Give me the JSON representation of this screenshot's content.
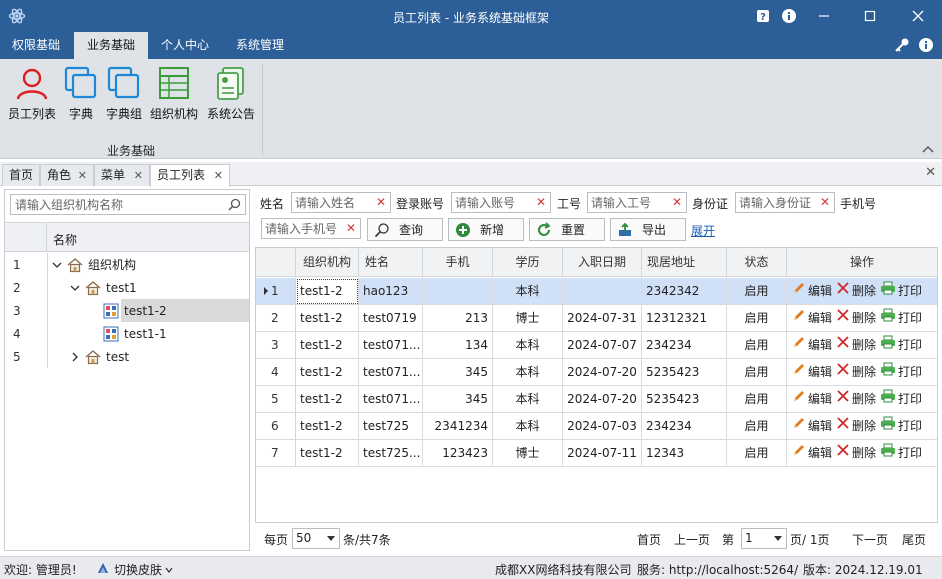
{
  "window": {
    "title": "员工列表 - 业务系统基础框架",
    "colors": {
      "titlebar": "#2c5f98",
      "ribbon": "#dfe3e8"
    }
  },
  "ribbon": {
    "tabs": [
      "权限基础",
      "业务基础",
      "个人中心",
      "系统管理"
    ],
    "active_tab": "业务基础",
    "buttons": [
      {
        "label": "员工列表",
        "icon": "person-icon"
      },
      {
        "label": "字典",
        "icon": "copy-icon"
      },
      {
        "label": "字典组",
        "icon": "copy-icon"
      },
      {
        "label": "组织机构",
        "icon": "table-icon"
      },
      {
        "label": "系统公告",
        "icon": "notice-icon"
      }
    ],
    "group_label": "业务基础"
  },
  "doc_tabs": [
    {
      "label": "首页",
      "closable": false
    },
    {
      "label": "角色",
      "closable": true
    },
    {
      "label": "菜单",
      "closable": true
    },
    {
      "label": "员工列表",
      "closable": true,
      "active": true
    }
  ],
  "tree": {
    "search_placeholder": "请输入组织机构名称",
    "column_header": "名称",
    "rows": [
      {
        "num": "1",
        "label": "组织机构",
        "expanded": true,
        "icon": "home-icon"
      },
      {
        "num": "2",
        "label": "test1",
        "expanded": true,
        "icon": "home-icon"
      },
      {
        "num": "3",
        "label": "test1-2",
        "icon": "org-leaf-icon",
        "selected": true
      },
      {
        "num": "4",
        "label": "test1-1",
        "icon": "org-leaf-icon"
      },
      {
        "num": "5",
        "label": "test",
        "expanded": false,
        "icon": "home-icon"
      }
    ]
  },
  "filters": {
    "name_label": "姓名",
    "name_placeholder": "请输入姓名",
    "account_label": "登录账号",
    "account_placeholder": "请输入账号",
    "jobno_label": "工号",
    "jobno_placeholder": "请输入工号",
    "idcard_label": "身份证",
    "idcard_placeholder": "请输入身份证",
    "phone_label": "手机号",
    "phone_placeholder": "请输入手机号",
    "query": "查询",
    "add": "新增",
    "reset": "重置",
    "export": "导出",
    "expand": "展开"
  },
  "grid": {
    "columns": [
      "组织机构",
      "姓名",
      "手机",
      "学历",
      "入职日期",
      "现居地址",
      "状态",
      "操作"
    ],
    "rows": [
      {
        "n": "1",
        "org": "test1-2",
        "name": "hao123",
        "phone": "",
        "edu": "本科",
        "date": "",
        "addr": "2342342",
        "status": "启用"
      },
      {
        "n": "2",
        "org": "test1-2",
        "name": "test0719",
        "phone": "213",
        "edu": "博士",
        "date": "2024-07-31",
        "addr": "12312321",
        "status": "启用"
      },
      {
        "n": "3",
        "org": "test1-2",
        "name": "test071...",
        "phone": "134",
        "edu": "本科",
        "date": "2024-07-07",
        "addr": "234234",
        "status": "启用"
      },
      {
        "n": "4",
        "org": "test1-2",
        "name": "test071...",
        "phone": "345",
        "edu": "本科",
        "date": "2024-07-20",
        "addr": "5235423",
        "status": "启用"
      },
      {
        "n": "5",
        "org": "test1-2",
        "name": "test071...",
        "phone": "345",
        "edu": "本科",
        "date": "2024-07-20",
        "addr": "5235423",
        "status": "启用"
      },
      {
        "n": "6",
        "org": "test1-2",
        "name": "test725",
        "phone": "2341234",
        "edu": "本科",
        "date": "2024-07-03",
        "addr": "234234",
        "status": "启用"
      },
      {
        "n": "7",
        "org": "test1-2",
        "name": "test725...",
        "phone": "123423",
        "edu": "博士",
        "date": "2024-07-11",
        "addr": "12343",
        "status": "启用"
      }
    ],
    "actions": {
      "edit": "编辑",
      "delete": "删除",
      "print": "打印"
    }
  },
  "pager": {
    "per_page_label": "每页",
    "per_page_value": "50",
    "total_text": "条/共7条",
    "first": "首页",
    "prev": "上一页",
    "page_label": "第",
    "page_value": "1",
    "page_suffix": "页/ 1页",
    "next": "下一页",
    "last": "尾页"
  },
  "status": {
    "welcome": "欢迎: 管理员!",
    "skin": "切换皮肤",
    "company": "成都XX网络科技有限公司",
    "service": "服务: http://localhost:5264/",
    "version": "版本: 2024.12.19.01"
  }
}
